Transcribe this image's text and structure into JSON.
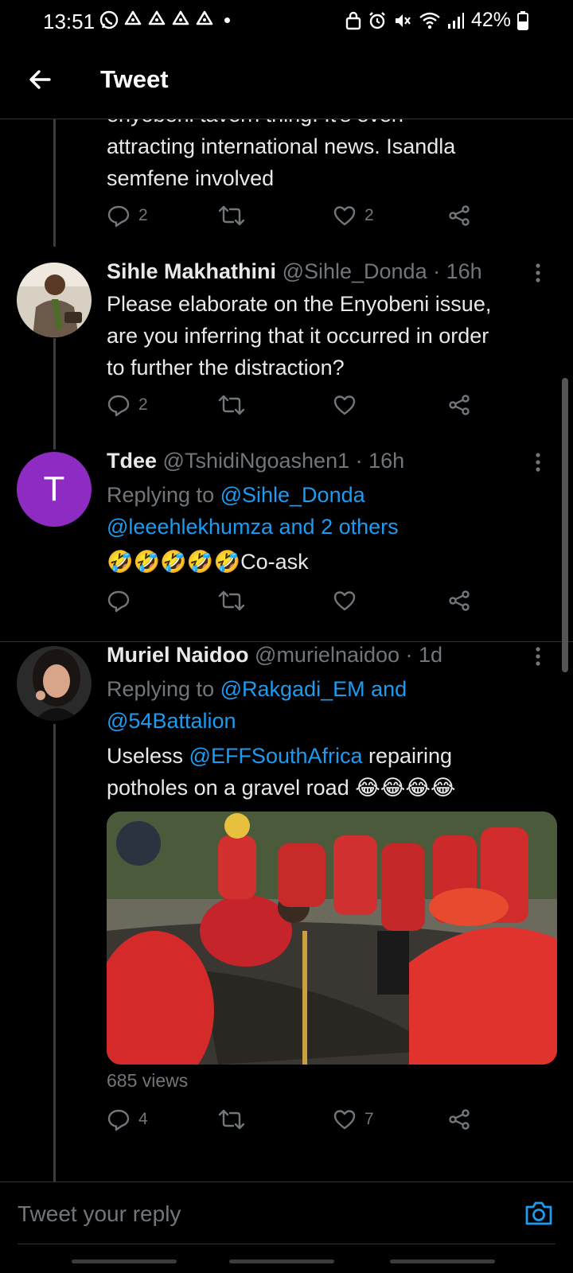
{
  "status_bar": {
    "time": "13:51",
    "battery": "42%",
    "notification_icons": [
      "whatsapp-icon",
      "recycle-icon",
      "recycle-icon",
      "recycle-icon",
      "recycle-icon"
    ]
  },
  "header": {
    "title": "Tweet"
  },
  "tweet_partial": {
    "text_line1": "enyobeni tavern thing. It's even",
    "text_line2": "attracting international news. Isandla",
    "text_line3": "semfene involved",
    "replies": "2",
    "likes": "2"
  },
  "tweet_sihle": {
    "name": "Sihle Makhathini",
    "handle": "@Sihle_Donda",
    "time": "· 16h",
    "text_line1": "Please elaborate on the Enyobeni issue,",
    "text_line2": "are you inferring that it occurred in order",
    "text_line3": "to further the distraction?",
    "replies": "2"
  },
  "tweet_tdee": {
    "name": "Tdee",
    "handle": "@TshidiNgoashen1",
    "time": "· 16h",
    "avatar_letter": "T",
    "replying_prefix": "Replying to ",
    "replying_user1": "@Sihle_Donda",
    "replying_user2": "@leeehlekhumza and 2 others",
    "emoji": "🤣🤣🤣🤣🤣",
    "text": "Co-ask"
  },
  "tweet_muriel": {
    "name": "Muriel Naidoo",
    "handle": "@murielnaidoo",
    "time": "· 1d",
    "replying_prefix": "Replying to ",
    "replying_user1": "@Rakgadi_EM and",
    "replying_user2": "@54Battalion",
    "text_before": "Useless ",
    "text_mention": "@EFFSouthAfrica",
    "text_after": " repairing",
    "text_line2": "potholes on a gravel road ",
    "emoji": "😂😂😂😂",
    "views": "685 views",
    "replies": "4",
    "likes": "7"
  },
  "reply_bar": {
    "placeholder": "Tweet your reply"
  },
  "colors": {
    "background": "#000000",
    "link": "#1d9bf0",
    "muted": "#71767b",
    "divider": "#2f3336",
    "tdee_avatar": "#8e2bc2"
  }
}
